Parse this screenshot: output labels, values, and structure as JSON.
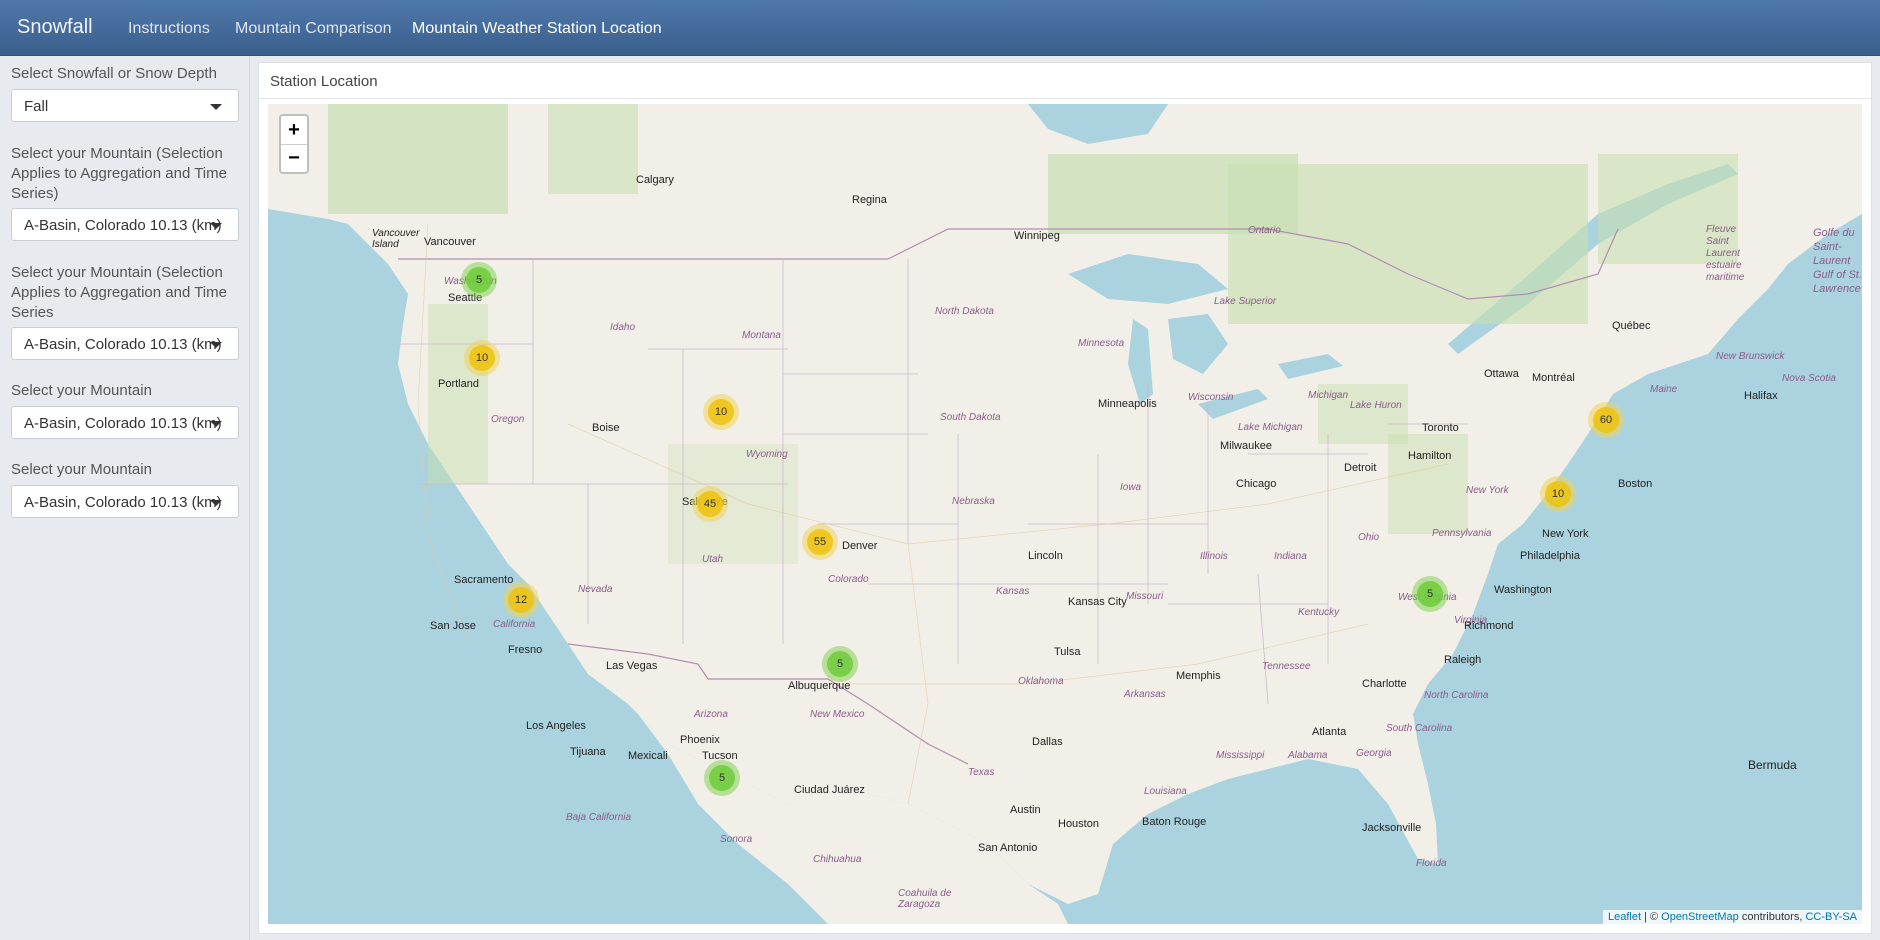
{
  "navbar": {
    "brand": "Snowfall",
    "items": [
      "Instructions",
      "Mountain Comparison",
      "Mountain Weather Station Location"
    ]
  },
  "sidebar": {
    "controls": [
      {
        "label": "Select Snowfall or Snow Depth",
        "value": "Fall"
      },
      {
        "label": "Select your Mountain (Selection Applies to Aggregation and Time Series)",
        "value": "A-Basin, Colorado 10.13 (km)"
      },
      {
        "label": "Select your Mountain (Selection Applies to Aggregation and Time Series",
        "value": "A-Basin, Colorado 10.13 (km)"
      },
      {
        "label": "Select your Mountain",
        "value": "A-Basin, Colorado 10.13 (km)"
      },
      {
        "label": "Select your Mountain",
        "value": "A-Basin, Colorado 10.13 (km)"
      }
    ]
  },
  "panel": {
    "title": "Station Location"
  },
  "map": {
    "zoom_in": "+",
    "zoom_out": "−",
    "markers": [
      {
        "count": "5",
        "color": "green"
      },
      {
        "count": "10",
        "color": "yellow"
      },
      {
        "count": "10",
        "color": "yellow"
      },
      {
        "count": "45",
        "color": "yellow"
      },
      {
        "count": "55",
        "color": "yellow"
      },
      {
        "count": "12",
        "color": "yellow"
      },
      {
        "count": "5",
        "color": "green"
      },
      {
        "count": "5",
        "color": "green"
      },
      {
        "count": "60",
        "color": "yellow"
      },
      {
        "count": "10",
        "color": "yellow"
      },
      {
        "count": "5",
        "color": "green"
      }
    ],
    "cities": [
      "Calgary",
      "Regina",
      "Winnipeg",
      "Vancouver",
      "Vancouver Island",
      "Seattle",
      "Portland",
      "Boise",
      "Salt Lake",
      "Denver",
      "Sacramento",
      "San Jose",
      "Fresno",
      "Las Vegas",
      "Los Angeles",
      "Tijuana",
      "Mexicali",
      "Phoenix",
      "Tucson",
      "Albuquerque",
      "Ciudad Juárez",
      "Dallas",
      "Austin",
      "Houston",
      "San Antonio",
      "Tulsa",
      "Kansas City",
      "Lincoln",
      "Minneapolis",
      "Milwaukee",
      "Chicago",
      "Detroit",
      "Toronto",
      "Hamilton",
      "Ottawa",
      "Montréal",
      "Québec",
      "Halifax",
      "Boston",
      "New York",
      "Philadelphia",
      "Washington",
      "Richmond",
      "Raleigh",
      "Charlotte",
      "Atlanta",
      "Memphis",
      "Baton Rouge",
      "Jacksonville",
      "Bermuda"
    ],
    "regions": [
      "Washington",
      "Idaho",
      "Montana",
      "Oregon",
      "Wyoming",
      "North Dakota",
      "South Dakota",
      "Minnesota",
      "Nebraska",
      "Iowa",
      "Utah",
      "Colorado",
      "Nevada",
      "California",
      "Arizona",
      "New Mexico",
      "Kansas",
      "Missouri",
      "Illinois",
      "Indiana",
      "Ohio",
      "Kentucky",
      "Tennessee",
      "Oklahoma",
      "Arkansas",
      "Texas",
      "Mississippi",
      "Alabama",
      "Georgia",
      "Louisiana",
      "Florida",
      "North Carolina",
      "South Carolina",
      "Virginia",
      "West Virginia",
      "Pennsylvania",
      "New York",
      "Wisconsin",
      "Michigan",
      "Ontario",
      "Lake Superior",
      "Lake Michigan",
      "Lake Huron",
      "Maine",
      "New Brunswick",
      "Nova Scotia",
      "Baja California",
      "Sonora",
      "Chihuahua",
      "Coahuila de Zaragoza",
      "Fleuve Saint Laurent estuaire maritime",
      "Golfe du Saint-Laurent Gulf of St. Lawrence"
    ],
    "attribution": {
      "leaflet": "Leaflet",
      "sep": " | © ",
      "osm": "OpenStreetMap",
      "contrib": " contributors, ",
      "license": "CC-BY-SA"
    }
  },
  "colors": {
    "navbar": "#4a6f9e",
    "land": "#f2efe9",
    "water": "#aad3df",
    "forest": "#c8dfb0"
  }
}
